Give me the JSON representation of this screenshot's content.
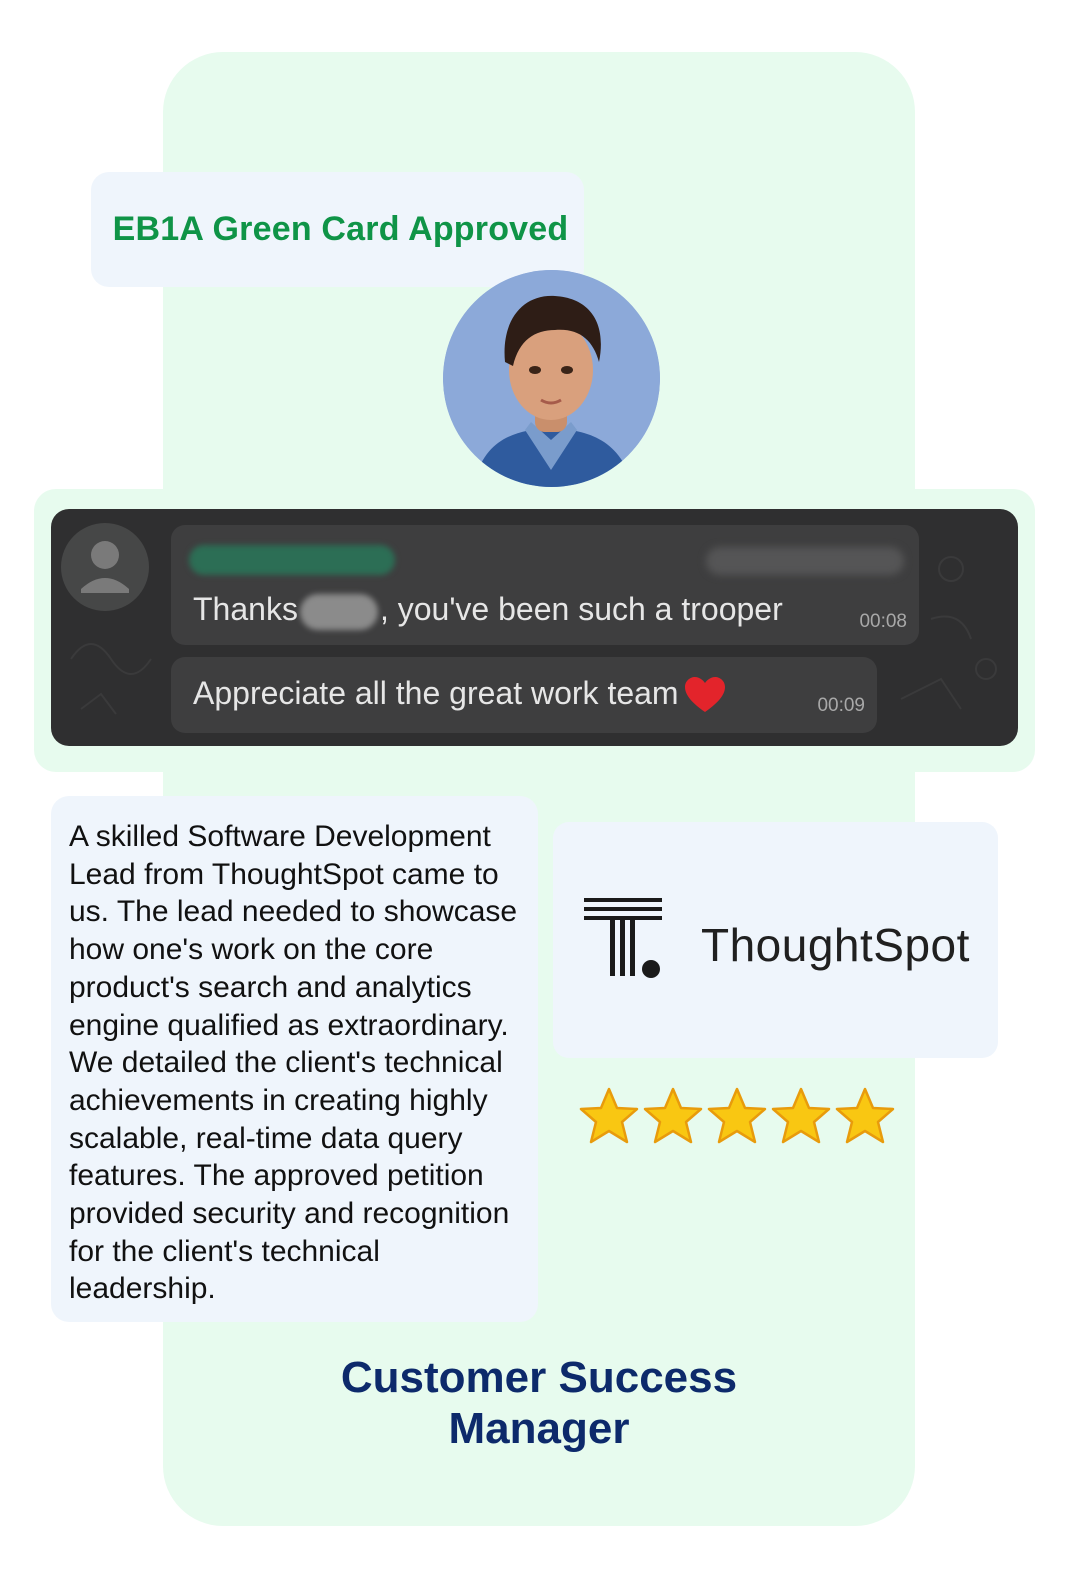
{
  "badge": {
    "label": "EB1A Green Card Approved"
  },
  "chat": {
    "messages": [
      {
        "prefix": "Thanks",
        "suffix": ", you've been such a trooper",
        "time": "00:08"
      },
      {
        "text": "Appreciate all the great work team",
        "time": "00:09",
        "emoji": "heart-icon"
      }
    ]
  },
  "description": "A skilled Software Development Lead from ThoughtSpot came to us. The lead needed to showcase how one's work on the core product's search and analytics engine qualified as extraordinary. We detailed the client's technical achievements in creating highly scalable, real-time data query features. The approved petition provided security and recognition for the client's technical leadership.",
  "company": {
    "name": "ThoughtSpot"
  },
  "rating": {
    "stars": 5,
    "max": 5
  },
  "role": {
    "line1": "Customer Success",
    "line2": "Manager"
  },
  "colors": {
    "accent_green": "#0f9447",
    "navy": "#0d2a6b",
    "card_bg": "#e7fbee",
    "panel_bg": "#eff5fc",
    "chat_bg": "#2f2f30"
  }
}
